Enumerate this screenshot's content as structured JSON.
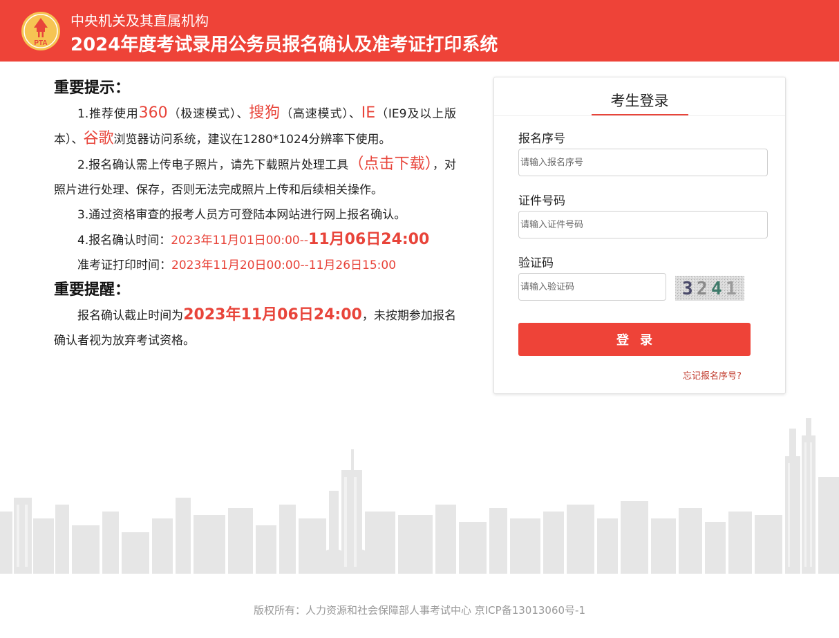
{
  "header": {
    "line1": "中央机关及其直属机构",
    "line2": "2024年度考试录用公务员报名确认及准考证打印系统",
    "logo_text": "PTA",
    "logo_color": "#f6c453"
  },
  "notice": {
    "heading1": "重要提示：",
    "p1": {
      "t1": "1.推荐使用",
      "b1": "360",
      "t2": "（极速模式）、",
      "b2": "搜狗",
      "t3": "（高速模式）、",
      "b3": "IE",
      "t4": "（IE9及以上版本）、",
      "b4": "谷歌",
      "t5": "浏览器访问系统，建议在1280*1024分辨率下使用。"
    },
    "p2": {
      "t1": "2.报名确认需上传电子照片，请先下载照片处理工具",
      "link": "（点击下载）",
      "t2": "，对照片进行处理、保存，否则无法完成照片上传和后续相关操作。"
    },
    "p3": "3.通过资格审查的报考人员方可登陆本网站进行网上报名确认。",
    "p4": {
      "label": "4.报名确认时间：",
      "start": "2023年11月01日00:00--",
      "end": "11月06日24:00"
    },
    "p5": {
      "label": "准考证打印时间：",
      "range": "2023年11月20日00:00--11月26日15:00"
    },
    "heading2": "重要提醒：",
    "p6": {
      "t1": "报名确认截止时间为",
      "deadline": "2023年11月06日24:00",
      "t2": "，未按期参加报名确认者视为放弃考试资格。"
    }
  },
  "login": {
    "title": "考生登录",
    "reg_label": "报名序号",
    "reg_placeholder": "请输入报名序号",
    "id_label": "证件号码",
    "id_placeholder": "请输入证件号码",
    "captcha_label": "验证码",
    "captcha_placeholder": "请输入验证码",
    "captcha_digits": [
      "3",
      "2",
      "4",
      "1"
    ],
    "button": "登录",
    "forgot": "忘记报名序号?"
  },
  "footer": {
    "copyright": "版权所有：人力资源和社会保障部人事考试中心 京ICP备13013060号-1"
  },
  "colors": {
    "brand_red": "#ee4338",
    "accent_red": "#e8443a",
    "skyline": "#e4e4e4"
  }
}
